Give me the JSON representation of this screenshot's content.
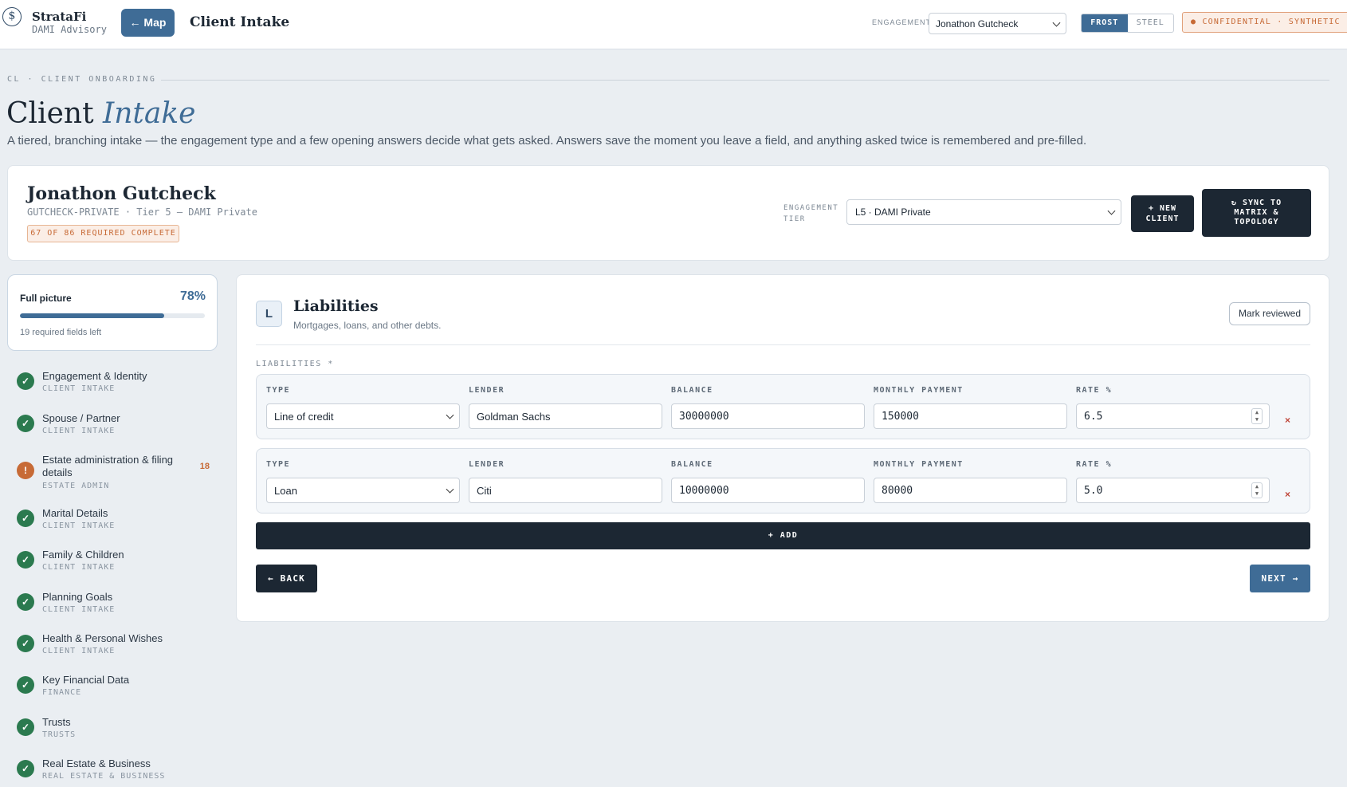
{
  "topbar": {
    "logo_icon": "dollar-icon",
    "brand_name": "StrataFi",
    "brand_sub": "DAMI Advisory",
    "map_button": "← Map",
    "title": "Client Intake",
    "engagement_label": "ENGAGEMENT",
    "engagement_value": "Jonathon Gutcheck",
    "theme_options": [
      "FROST",
      "STEEL"
    ],
    "theme_selected": "FROST",
    "confidential_badge": "● CONFIDENTIAL · SYNTHETIC"
  },
  "header": {
    "eyebrow": "CL · CLIENT ONBOARDING",
    "title_main": "Client",
    "title_accent": "Intake",
    "description": "A tiered, branching intake — the engagement type and a few opening answers decide what gets asked. Answers save the moment you leave a field, and anything asked twice is remembered and pre-filled."
  },
  "client": {
    "name": "Jonathon Gutcheck",
    "meta": "GUTCHECK-PRIVATE · Tier 5 — DAMI Private",
    "required_badge": "67 OF 86 REQUIRED COMPLETE",
    "tier_label_line1": "ENGAGEMENT",
    "tier_label_line2": "TIER",
    "tier_value": "L5 · DAMI Private",
    "new_client_line1": "+ NEW",
    "new_client_line2": "CLIENT",
    "sync_line1": "↻ SYNC TO",
    "sync_line2": "MATRIX &",
    "sync_line3": "TOPOLOGY"
  },
  "progress": {
    "label": "Full picture",
    "percent_text": "78%",
    "percent_value": 0.78,
    "remaining": "19 required fields left"
  },
  "sidebar": {
    "items": [
      {
        "title": "Engagement & Identity",
        "sub": "CLIENT INTAKE",
        "status": "complete"
      },
      {
        "title": "Spouse / Partner",
        "sub": "CLIENT INTAKE",
        "status": "complete"
      },
      {
        "title": "Estate administration & filing details",
        "sub": "ESTATE ADMIN",
        "status": "incomplete",
        "count": "18"
      },
      {
        "title": "Marital Details",
        "sub": "CLIENT INTAKE",
        "status": "complete"
      },
      {
        "title": "Family & Children",
        "sub": "CLIENT INTAKE",
        "status": "complete"
      },
      {
        "title": "Planning Goals",
        "sub": "CLIENT INTAKE",
        "status": "complete"
      },
      {
        "title": "Health & Personal Wishes",
        "sub": "CLIENT INTAKE",
        "status": "complete"
      },
      {
        "title": "Key Financial Data",
        "sub": "FINANCE",
        "status": "complete"
      },
      {
        "title": "Trusts",
        "sub": "TRUSTS",
        "status": "complete"
      },
      {
        "title": "Real Estate & Business",
        "sub": "REAL ESTATE & BUSINESS",
        "status": "complete"
      }
    ],
    "check_glyph": "✓",
    "warn_glyph": "!"
  },
  "section": {
    "letter": "L",
    "title": "Liabilities",
    "subtitle": "Mortgages, loans, and other debts.",
    "review_button": "Mark reviewed",
    "list_label": "LIABILITIES *",
    "columns": [
      "TYPE",
      "LENDER",
      "BALANCE",
      "MONTHLY PAYMENT",
      "RATE %"
    ],
    "rows": [
      {
        "type": "Line of credit",
        "lender": "Goldman Sachs",
        "balance": "30000000",
        "monthly_payment": "150000",
        "rate": "6.5"
      },
      {
        "type": "Loan",
        "lender": "Citi",
        "balance": "10000000",
        "monthly_payment": "80000",
        "rate": "5.0"
      }
    ],
    "remove_glyph": "×",
    "add_button": "+ ADD",
    "back_button": "← BACK",
    "next_button": "NEXT →"
  },
  "colors": {
    "accent": "#3f6c96",
    "dark": "#1c2733",
    "complete": "#2b7a4f",
    "warning": "#c76a36"
  }
}
